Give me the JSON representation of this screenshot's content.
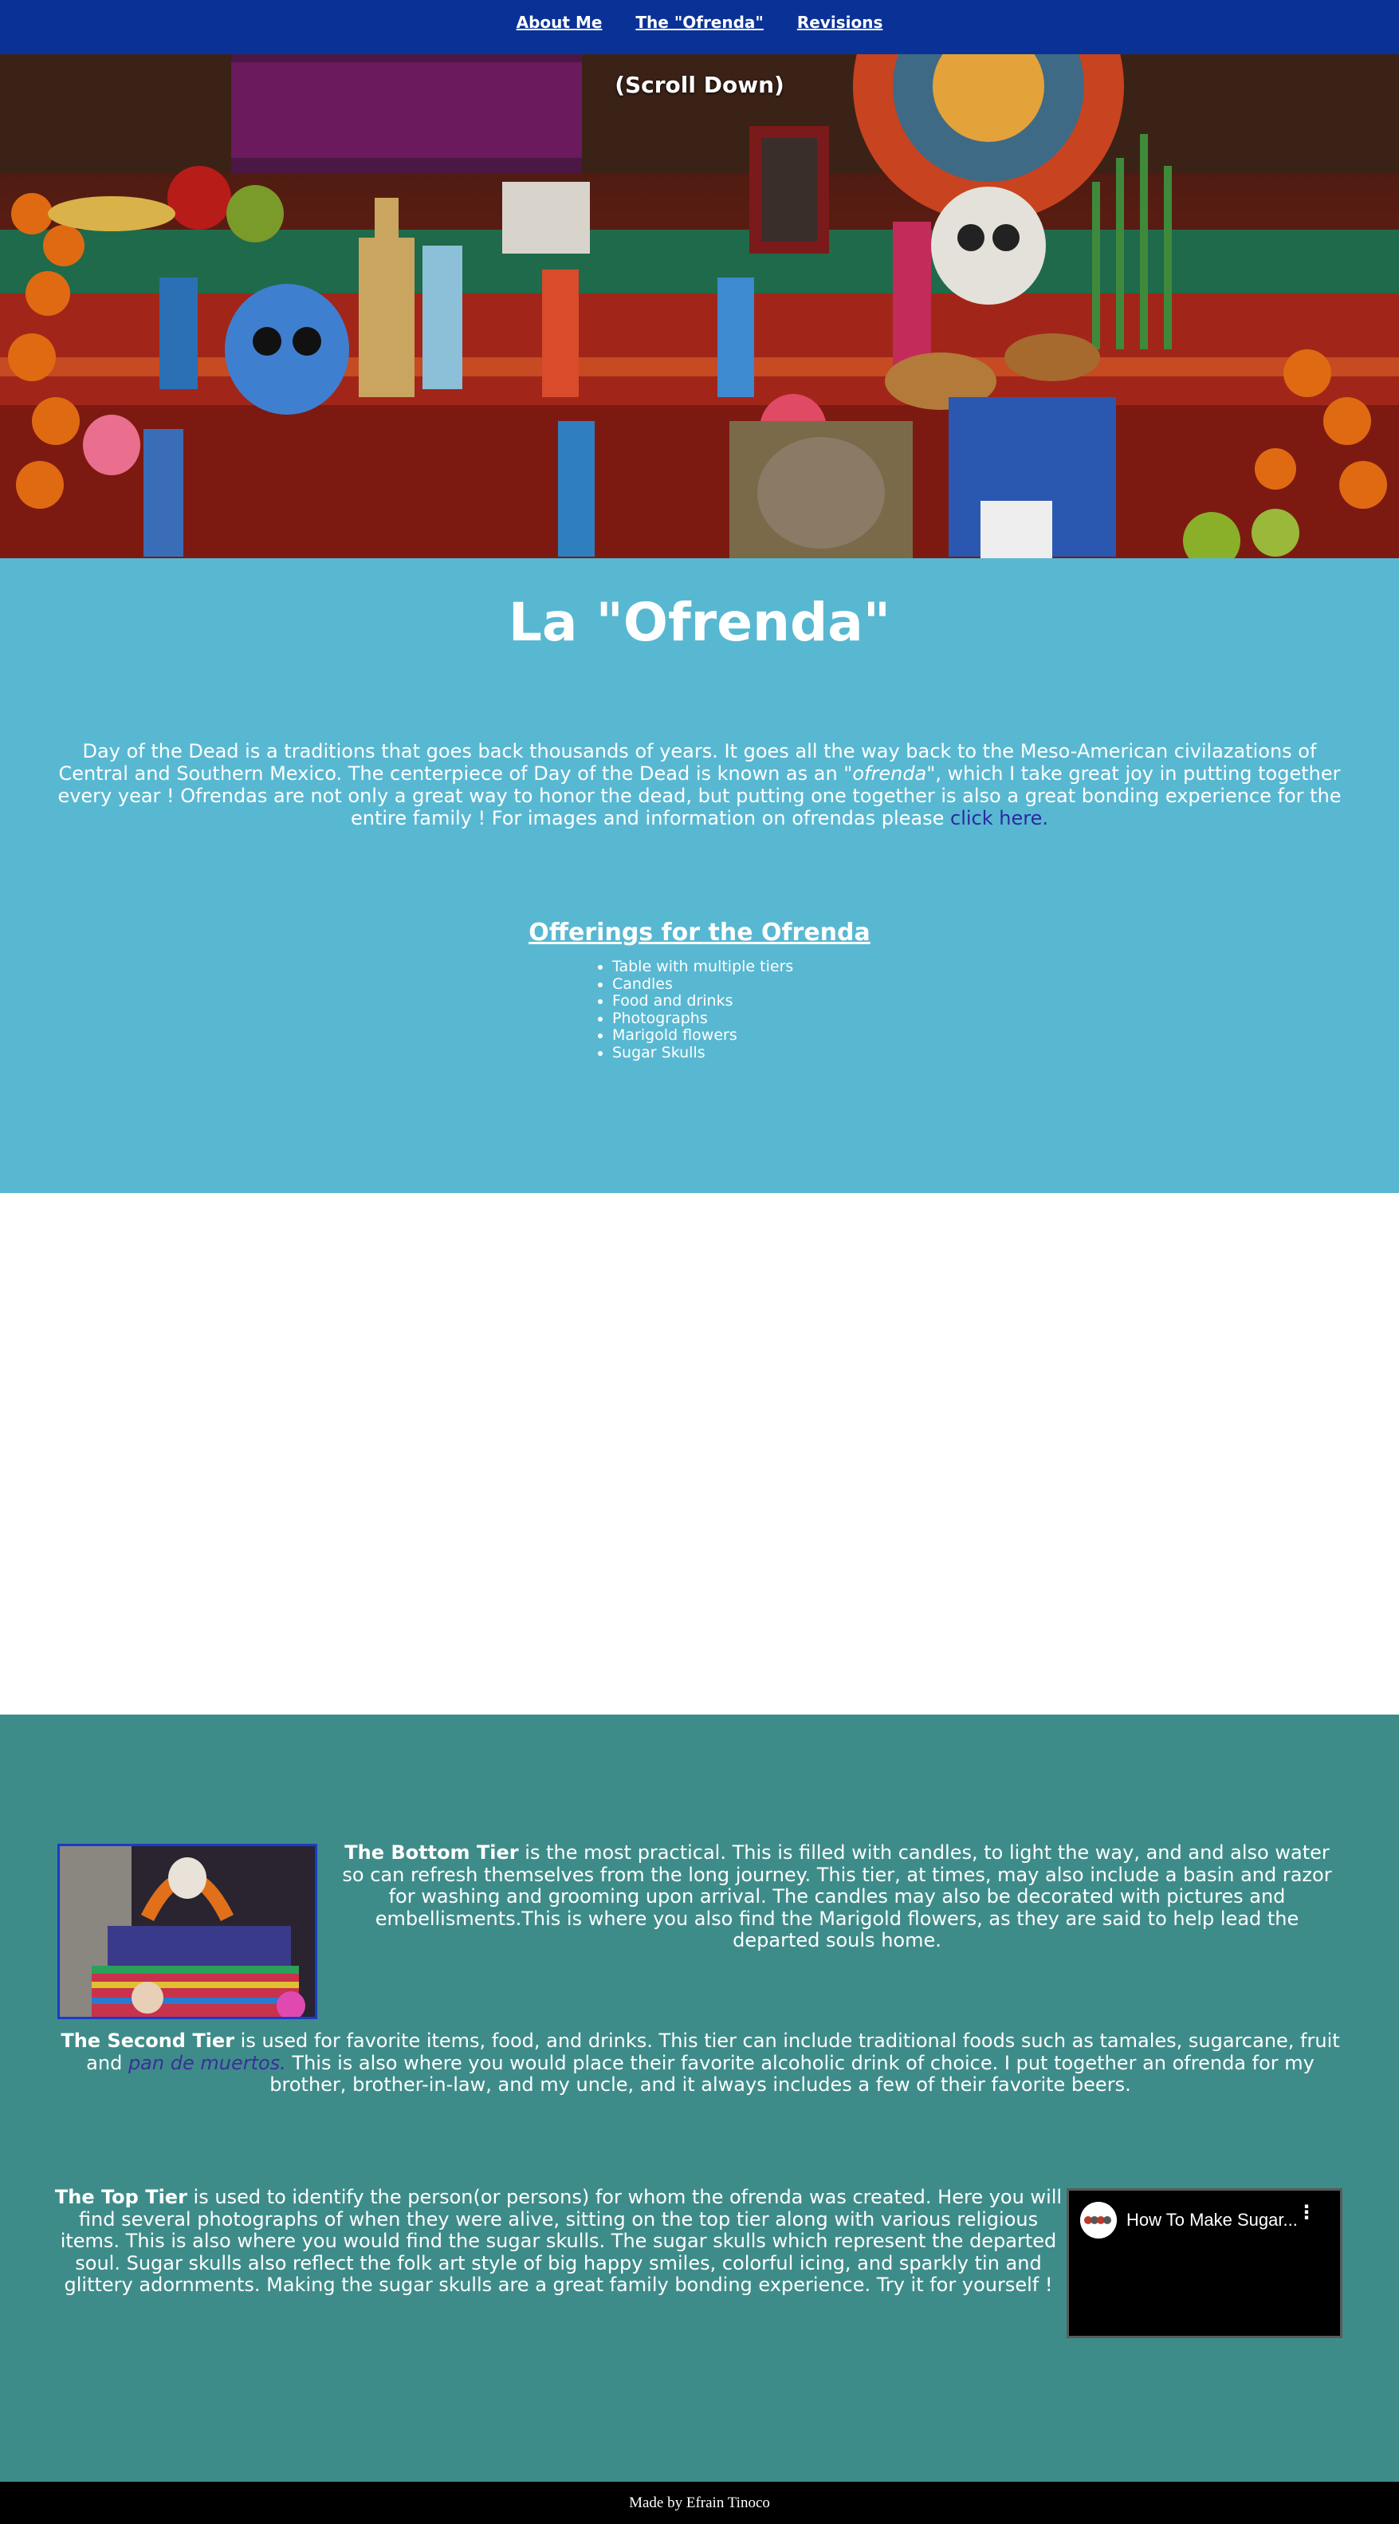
{
  "nav": {
    "items": [
      {
        "label": "About Me"
      },
      {
        "label": "The \"Ofrenda\""
      },
      {
        "label": "Revisions"
      }
    ]
  },
  "hero": {
    "scroll_text": "(Scroll Down)"
  },
  "ofrenda": {
    "title": "La \"Ofrenda\"",
    "intro_text": "Day of the Dead is a traditions that goes back thousands of years. It goes all the way back to the Meso-American civilazations of Central and Southern Mexico. The centerpiece of Day of the Dead is known as an ",
    "intro_em": "\"ofrenda\"",
    "intro_text2": ", which I take great joy in putting together every year ! Ofrendas are not only a great way to honor the dead, but putting one together is also a great bonding experience for the entire family ! For images and information on ofrendas please ",
    "intro_link": "click here.",
    "offerings_title": "Offerings for the Ofrenda",
    "offerings": [
      "Table with multiple tiers",
      "Candles",
      "Food and drinks",
      "Photographs",
      "Marigold flowers",
      "Sugar Skulls"
    ]
  },
  "tiers": {
    "bottom_label": "The Bottom Tier",
    "bottom_text": " is the most practical. This is filled with candles, to light the way, and and also water so can refresh themselves from the long journey. This tier, at times, may also include a basin and razor for washing and grooming upon arrival. The candles may also be decorated with pictures and embellisments.This is where you also find the Marigold flowers, as they are said to help lead the departed souls home.",
    "second_label": "The Second Tier",
    "second_text": " is used for favorite items, food, and drinks. This tier can include traditional foods such as tamales, sugarcane, fruit and ",
    "second_link": "pan de muertos.",
    "second_text2": " This is also where you would place their favorite alcoholic drink of choice. I put together an ofrenda for my brother, brother-in-law, and my uncle, and it always includes a few of their favorite beers.",
    "top_label": "The Top Tier",
    "top_text": " is used to identify the person(or persons) for whom the ofrenda was created. Here you will find several photographs of when they were alive, sitting on the top tier along with various religious items. This is also where you would find the sugar skulls. The sugar skulls which represent the departed soul. Sugar skulls also reflect the folk art style of big happy smiles, colorful icing, and sparkly tin and glittery adornments. Making the sugar skulls are a great family bonding experience. Try it for yourself !",
    "video_title": "How To Make Sugar..."
  },
  "footer": {
    "text": "Made by Efrain Tinoco"
  },
  "colors": {
    "nav_bg": "#0a3296",
    "ofrenda_bg": "#58b8d2",
    "tiers_bg": "#3e8c8a",
    "footer_bg": "#000000"
  }
}
